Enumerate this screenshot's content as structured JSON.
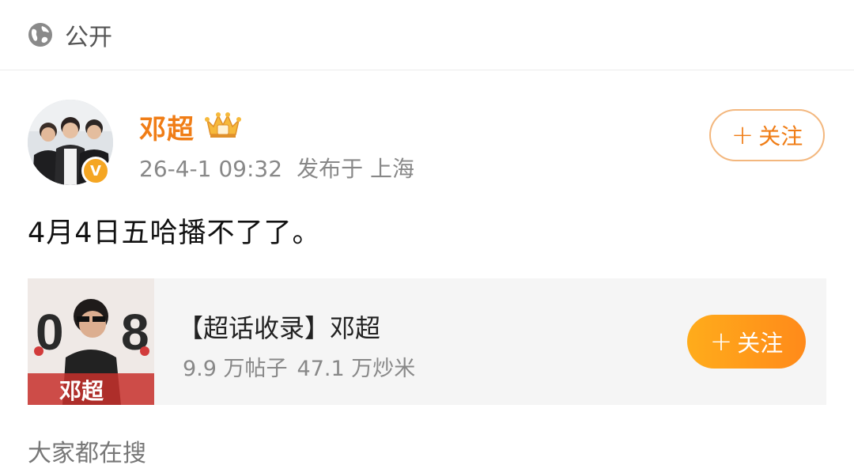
{
  "visibility": {
    "icon": "globe-icon",
    "label": "公开"
  },
  "post": {
    "author": "邓超",
    "author_badge": "crown-icon",
    "verified_badge": "V",
    "time": "26-4-1 09:32",
    "location": "发布于 上海",
    "follow_label": "关注",
    "text": "4月4日五哈播不了了。"
  },
  "card": {
    "title": "【超话收录】邓超",
    "posts_count": "9.9 万帖子",
    "fans_count": "47.1 万炒米",
    "follow_label": "关注",
    "thumb_numbers": "0 8",
    "thumb_name": "邓超"
  },
  "section": {
    "title": "大家都在搜"
  },
  "colors": {
    "accent": "#f07d16",
    "button_gradient_start": "#ffac1b",
    "button_gradient_end": "#ff8a1a"
  }
}
